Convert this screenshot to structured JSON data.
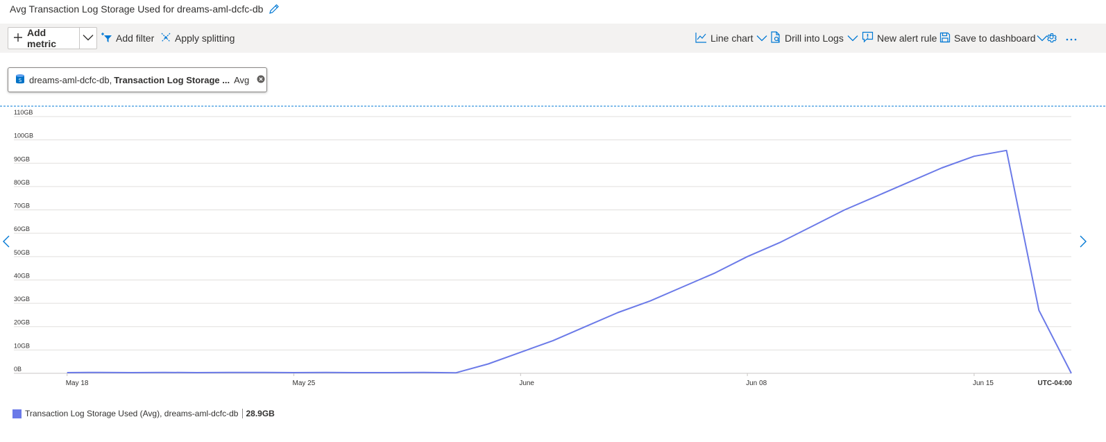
{
  "header": {
    "title": "Avg Transaction Log Storage Used for dreams-aml-dcfc-db"
  },
  "toolbar": {
    "add_metric": "Add metric",
    "add_filter": "Add filter",
    "apply_splitting": "Apply splitting",
    "line_chart": "Line chart",
    "drill_into_logs": "Drill into Logs",
    "new_alert_rule": "New alert rule",
    "save_to_dashboard": "Save to dashboard"
  },
  "metric_pill": {
    "resource": "dreams-aml-dcfc-db,",
    "metric": "Transaction Log Storage ...",
    "aggregation": "Avg"
  },
  "legend": {
    "label": "Transaction Log Storage Used (Avg), dreams-aml-dcfc-db",
    "value": "28.9GB"
  },
  "colors": {
    "series": "#6b7ae8",
    "accent": "#0078d4",
    "grid": "#e1dfdd",
    "toolbar_bg": "#f3f2f1"
  },
  "chart_data": {
    "type": "line",
    "y_unit": "GB",
    "ylim": [
      0,
      110
    ],
    "y_ticks": [
      "0B",
      "10GB",
      "20GB",
      "30GB",
      "40GB",
      "50GB",
      "60GB",
      "70GB",
      "80GB",
      "90GB",
      "100GB",
      "110GB"
    ],
    "x_range": [
      "May 17",
      "Jun 18"
    ],
    "x_ticks": [
      {
        "date": "May 18",
        "label": "May 18"
      },
      {
        "date": "May 25",
        "label": "May 25"
      },
      {
        "date": "Jun 01",
        "label": "June"
      },
      {
        "date": "Jun 08",
        "label": "Jun 08"
      },
      {
        "date": "Jun 15",
        "label": "Jun 15"
      }
    ],
    "timezone_label": "UTC-04:00",
    "grid": true,
    "series": [
      {
        "name": "Transaction Log Storage Used (Avg), dreams-aml-dcfc-db",
        "x": [
          "May 18",
          "May 19",
          "May 20",
          "May 21",
          "May 22",
          "May 23",
          "May 24",
          "May 25",
          "May 26",
          "May 27",
          "May 28",
          "May 29",
          "May 30",
          "May 31",
          "Jun 01",
          "Jun 02",
          "Jun 03",
          "Jun 04",
          "Jun 05",
          "Jun 06",
          "Jun 07",
          "Jun 08",
          "Jun 09",
          "Jun 10",
          "Jun 11",
          "Jun 12",
          "Jun 13",
          "Jun 14",
          "Jun 15",
          "Jun 16",
          "Jun 17",
          "Jun 18"
        ],
        "values": [
          0.3,
          0.4,
          0.3,
          0.4,
          0.3,
          0.4,
          0.4,
          0.3,
          0.4,
          0.3,
          0.3,
          0.4,
          0.2,
          4,
          9,
          14,
          20,
          26,
          31,
          37,
          43,
          50,
          56,
          63,
          70,
          76,
          82,
          88,
          93,
          95.5,
          27,
          0
        ]
      }
    ]
  }
}
